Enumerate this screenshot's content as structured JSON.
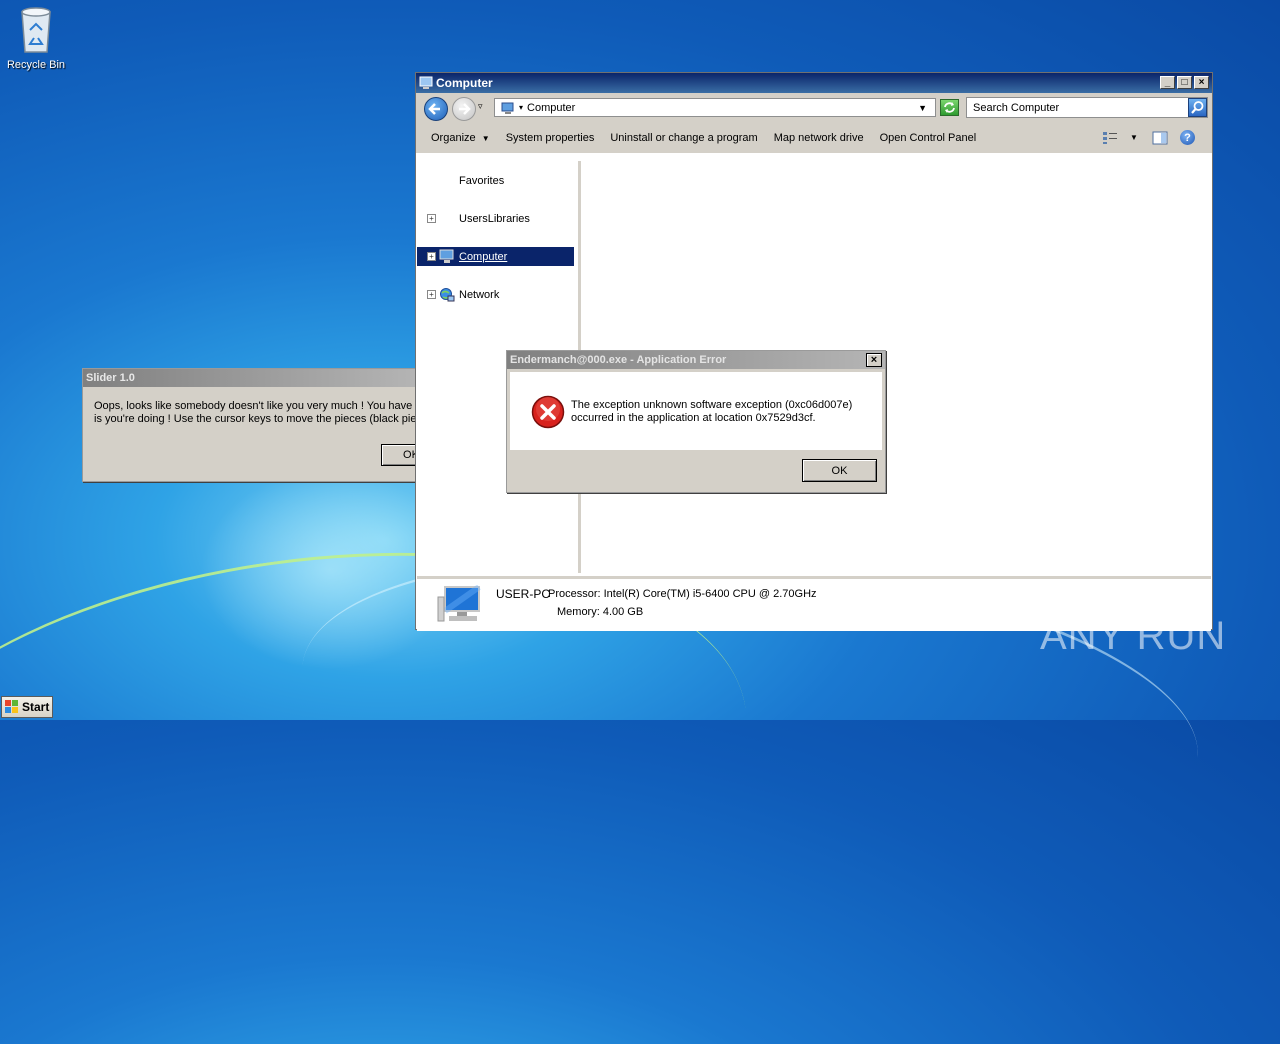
{
  "desktop": {
    "recycle_bin_label": "Recycle Bin",
    "watermark": "ANY RUN"
  },
  "taskbar": {
    "start_label": "Start"
  },
  "slider_window": {
    "title": "Slider 1.0",
    "message_line1": "Oops, looks like somebody doesn't like you very much ! You have to",
    "message_line2": "is you're doing ! Use the cursor keys to move the pieces (black piec",
    "ok_label": "OK"
  },
  "explorer": {
    "title": "Computer",
    "address": "Computer",
    "search_placeholder": "Search Computer",
    "commands": [
      "Organize",
      "System properties",
      "Uninstall or change a program",
      "Map network drive",
      "Open Control Panel"
    ],
    "tree": [
      {
        "label": "Favorites"
      },
      {
        "label": "UsersLibraries"
      },
      {
        "label": "Computer"
      },
      {
        "label": "Network"
      }
    ],
    "details": {
      "name": "USER-PC",
      "processor": "Processor: Intel(R) Core(TM) i5-6400 CPU @ 2.70GHz",
      "memory": "Memory: 4.00 GB"
    }
  },
  "error_dialog": {
    "title": "Endermanch@000.exe - Application Error",
    "line1": "The exception unknown software exception (0xc06d007e)",
    "line2": "occurred in the application at location 0x7529d3cf.",
    "ok_label": "OK"
  }
}
